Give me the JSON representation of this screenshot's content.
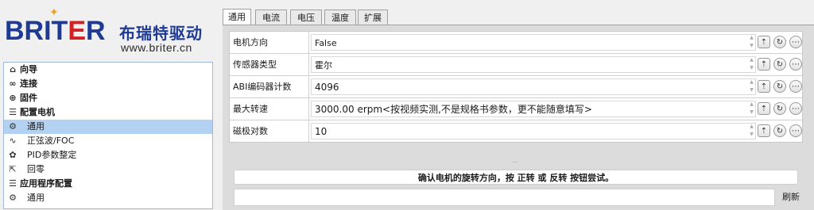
{
  "logo": {
    "brand_main": "BRIT",
    "brand_e": "E",
    "brand_end": "R",
    "chinese": "布瑞特驱动",
    "url": "www.briter.cn"
  },
  "tree": {
    "items": [
      {
        "label": "向导",
        "icon": "home-icon",
        "glyph": "⌂"
      },
      {
        "label": "连接",
        "icon": "link-icon",
        "glyph": "∞"
      },
      {
        "label": "固件",
        "icon": "firmware-icon",
        "glyph": "⊕"
      },
      {
        "label": "配置电机",
        "icon": "sliders-icon",
        "glyph": "☰"
      },
      {
        "label": "通用",
        "icon": "gear-icon",
        "glyph": "⚙"
      },
      {
        "label": "正弦波/FOC",
        "icon": "sine-wave-icon",
        "glyph": "∿"
      },
      {
        "label": "PID参数整定",
        "icon": "tuning-icon",
        "glyph": "✿"
      },
      {
        "label": "回零",
        "icon": "home-return-icon",
        "glyph": "⇱"
      },
      {
        "label": "应用程序配置",
        "icon": "sliders-icon",
        "glyph": "☰"
      },
      {
        "label": "通用",
        "icon": "gear-icon",
        "glyph": "⚙"
      }
    ]
  },
  "tabs": [
    "通用",
    "电流",
    "电压",
    "温度",
    "扩展"
  ],
  "params": [
    {
      "label": "电机方向",
      "value": "False"
    },
    {
      "label": "传感器类型",
      "value": "霍尔"
    },
    {
      "label": "ABI编码器计数",
      "value": "4096"
    },
    {
      "label": "最大转速",
      "value": "3000.00   erpm<按视频实测,不是规格书参数，更不能随意填写>"
    },
    {
      "label": "磁极对数",
      "value": "10"
    }
  ],
  "splitter": "...",
  "confirm_text": "确认电机的旋转方向，按 正转 或 反转 按钮尝试。",
  "refresh_label": "刷新",
  "colors": {
    "brand_blue": "#1f3a93",
    "brand_red": "#d32020",
    "selection": "#b3d2f2"
  }
}
